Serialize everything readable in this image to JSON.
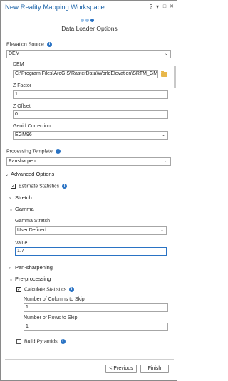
{
  "window": {
    "title": "New Reality Mapping Workspace",
    "help_btn": "?",
    "menu_btn": "▾",
    "restore_btn": "□",
    "close_btn": "✕"
  },
  "wizard": {
    "step_count": 3,
    "current_step": 3,
    "subtitle": "Data Loader Options"
  },
  "elevation": {
    "section_label": "Elevation Source",
    "source_value": "DEM",
    "dem_label": "DEM",
    "dem_path": "C:\\Program Files\\ArcGIS\\RasterData\\WorldElevation\\SRTM_GMTED",
    "z_factor_label": "Z Factor",
    "z_factor_value": "1",
    "z_offset_label": "Z Offset",
    "z_offset_value": "0",
    "geoid_label": "Geoid Correction",
    "geoid_value": "EGM96"
  },
  "processing": {
    "template_label": "Processing Template",
    "template_value": "Pansharpen"
  },
  "advanced": {
    "label": "Advanced Options",
    "estimate_statistics_label": "Estimate Statistics",
    "estimate_statistics_checked": true,
    "stretch_label": "Stretch",
    "gamma_label": "Gamma",
    "gamma_stretch_label": "Gamma Stretch",
    "gamma_stretch_value": "User Defined",
    "value_label": "Value",
    "value_value": "1.7",
    "pansharpening_label": "Pan-sharpening",
    "preprocessing_label": "Pre-processing",
    "calculate_statistics_label": "Calculate Statistics",
    "calculate_statistics_checked": true,
    "columns_skip_label": "Number of Columns to Skip",
    "columns_skip_value": "1",
    "rows_skip_label": "Number of Rows to Skip",
    "rows_skip_value": "1",
    "build_pyramids_label": "Build Pyramids",
    "build_pyramids_checked": false
  },
  "footer": {
    "previous_label": "< Previous",
    "finish_label": "Finish"
  },
  "icons": {
    "info": "info-icon",
    "folder": "folder-icon",
    "chevron_down": "chevron-down-icon",
    "expander_open": "caret-down-icon",
    "expander_closed": "caret-right-icon",
    "checkmark": "checkmark-icon"
  },
  "colors": {
    "title": "#1b63a8",
    "accent": "#2a73c4",
    "info": "#2a73c4",
    "folder": "#e8b74a",
    "step_inactive": "#9cc2e8"
  }
}
